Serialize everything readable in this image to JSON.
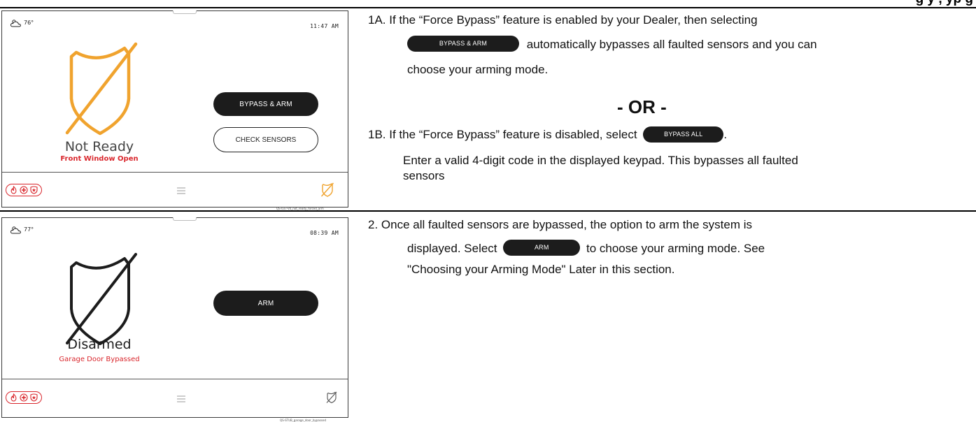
{
  "header_fragment": "g                    y         ,        yp       g",
  "screen1": {
    "temperature": "76°",
    "time": "11:47 AM",
    "status": "Not Ready",
    "substatus": "Front Window Open",
    "buttons": {
      "primary": "BYPASS & ARM",
      "secondary": "CHECK SENSORS"
    },
    "caption": "QS-037-V0_not_ready_forced_arm",
    "colors": {
      "shield": "#f0a32e",
      "alert": "#d9262c"
    }
  },
  "screen2": {
    "temperature": "77°",
    "time": "08:39 AM",
    "status": "Disarmed",
    "substatus": "Garage Door Bypassed",
    "buttons": {
      "primary": "ARM"
    },
    "caption": "QS-STUB_garage_door_bypassed",
    "colors": {
      "shield": "#1c1c1c",
      "alert": "#d9262c"
    }
  },
  "instructions": {
    "step1a": {
      "line1": "1A.  If the “Force Bypass” feature is enabled by your Dealer, then selecting",
      "button": "BYPASS & ARM",
      "line2": "automatically bypasses all faulted sensors and you can",
      "line3": "choose your arming mode."
    },
    "or": "- OR -",
    "step1b": {
      "line1": "1B. If the “Force Bypass” feature is disabled, select",
      "button": "BYPASS ALL",
      "line1_end": ".",
      "line2": "Enter a valid 4-digit code in the displayed keypad.  This bypasses all faulted",
      "line3": "sensors"
    },
    "step2": {
      "line1": "2.  Once all faulted sensors are bypassed, the option to arm the system is",
      "line2_start": "displayed.  Select",
      "button": "ARM",
      "line2_end": "to choose your arming mode.  See",
      "line3": "\"Choosing your Arming Mode\" Later in this section."
    }
  }
}
